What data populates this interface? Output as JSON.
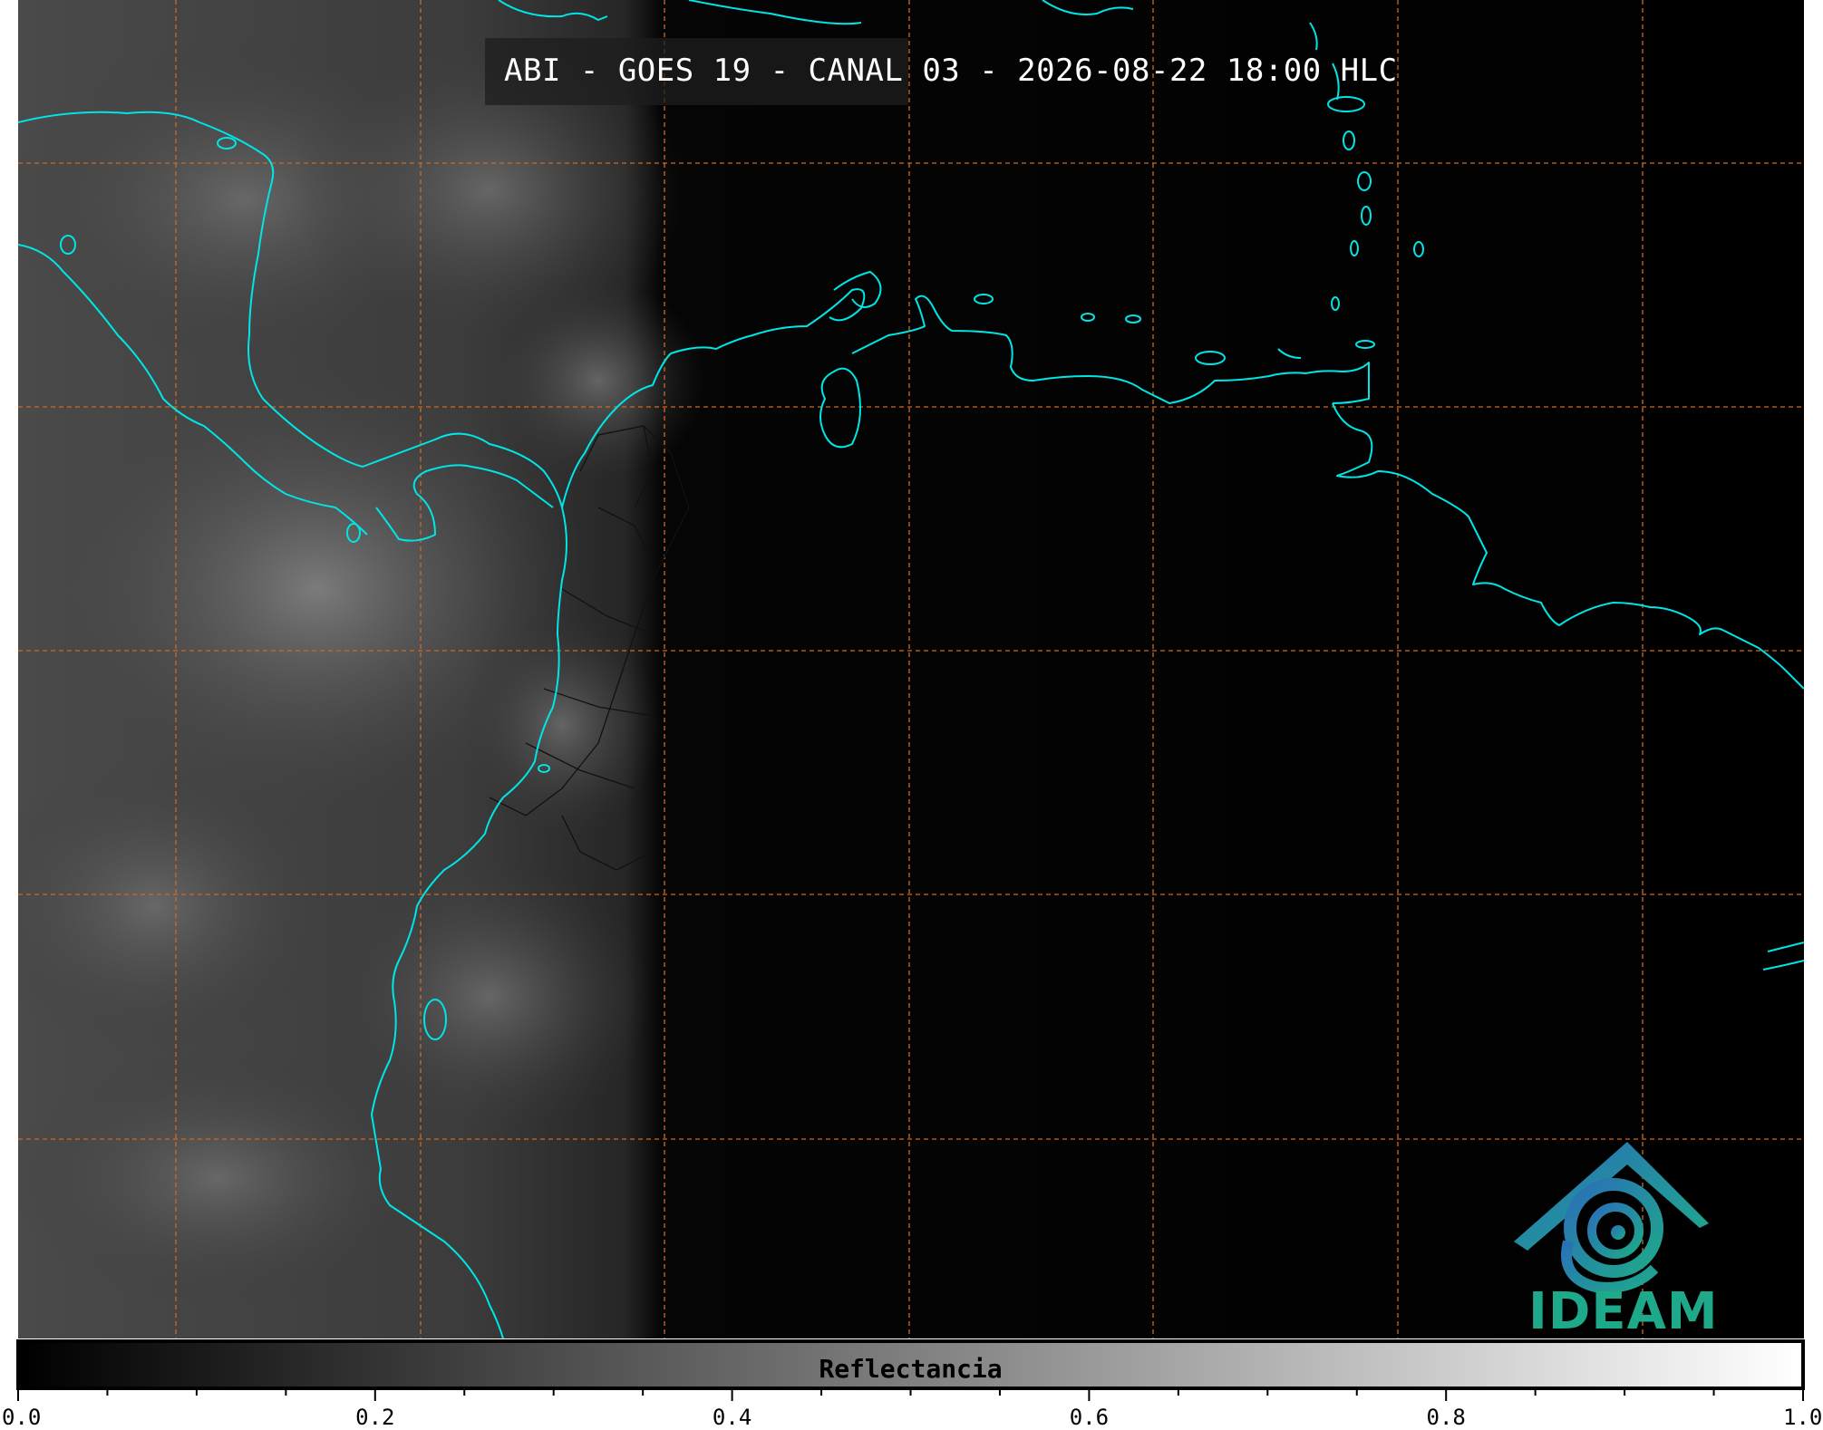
{
  "title": "ABI - GOES 19 - CANAL 03 - 2026-08-22 18:00 HLC",
  "colorbar": {
    "label": "Reflectancia",
    "min": 0.0,
    "max": 1.0,
    "major_ticks": [
      "0.0",
      "0.2",
      "0.4",
      "0.6",
      "0.8",
      "1.0"
    ],
    "minor_step": 0.05
  },
  "logo": {
    "text": "IDEAM"
  },
  "colors": {
    "coastline": "#00e5e5",
    "gridline": "#d2691e",
    "borders": "#1a1a1a",
    "logo_teal": "#1ea98a",
    "logo_blue": "#2a6fb8"
  },
  "gridlines": {
    "style": "dashed",
    "vertical_count": 7,
    "horizontal_count": 5
  }
}
